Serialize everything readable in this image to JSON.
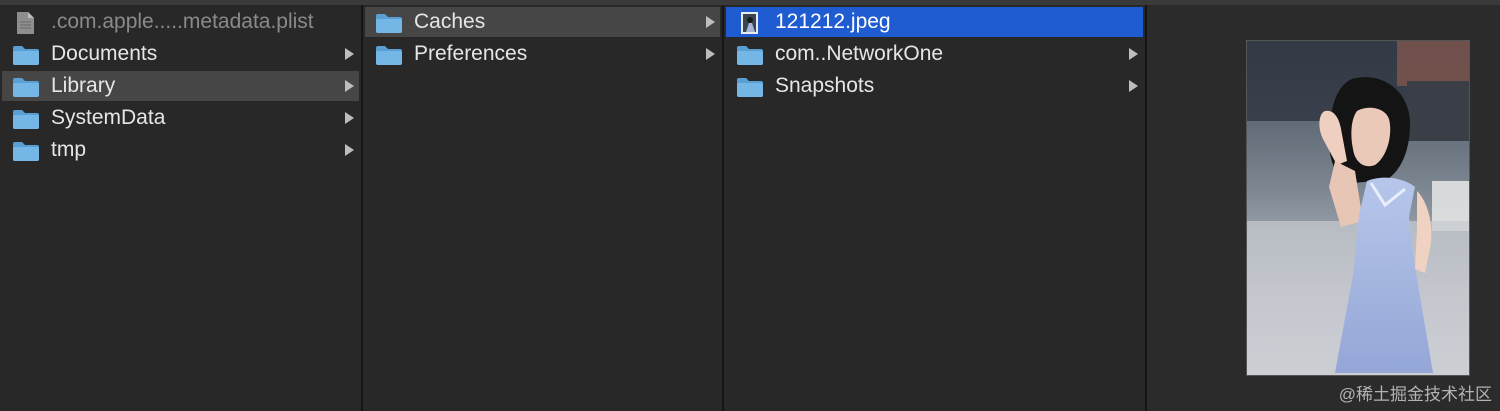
{
  "columns": [
    {
      "items": [
        {
          "label": ".com.apple.....metadata.plist",
          "kind": "file",
          "has_children": false,
          "state": "dim"
        },
        {
          "label": "Documents",
          "kind": "folder",
          "has_children": true,
          "state": "normal"
        },
        {
          "label": "Library",
          "kind": "folder",
          "has_children": true,
          "state": "path-selected"
        },
        {
          "label": "SystemData",
          "kind": "folder",
          "has_children": true,
          "state": "normal"
        },
        {
          "label": "tmp",
          "kind": "folder",
          "has_children": true,
          "state": "normal"
        }
      ]
    },
    {
      "items": [
        {
          "label": "Caches",
          "kind": "folder",
          "has_children": true,
          "state": "path-selected"
        },
        {
          "label": "Preferences",
          "kind": "folder",
          "has_children": true,
          "state": "normal"
        }
      ]
    },
    {
      "items": [
        {
          "label": "121212.jpeg",
          "kind": "image-file",
          "has_children": false,
          "state": "selected"
        },
        {
          "label": "com..NetworkOne",
          "kind": "folder",
          "has_children": true,
          "state": "normal"
        },
        {
          "label": "Snapshots",
          "kind": "folder",
          "has_children": true,
          "state": "normal"
        }
      ]
    }
  ],
  "icons": {
    "folder": "folder-icon",
    "file": "document-icon",
    "image": "image-thumbnail-icon",
    "chevron": "chevron-right-icon"
  },
  "preview": {
    "image": "photo-preview",
    "watermark": "@稀土掘金技术社区"
  },
  "colors": {
    "background": "#282828",
    "selection_blue": "#1f5bd1",
    "selection_gray": "#464646",
    "folder_blue": "#6fb2e2"
  }
}
